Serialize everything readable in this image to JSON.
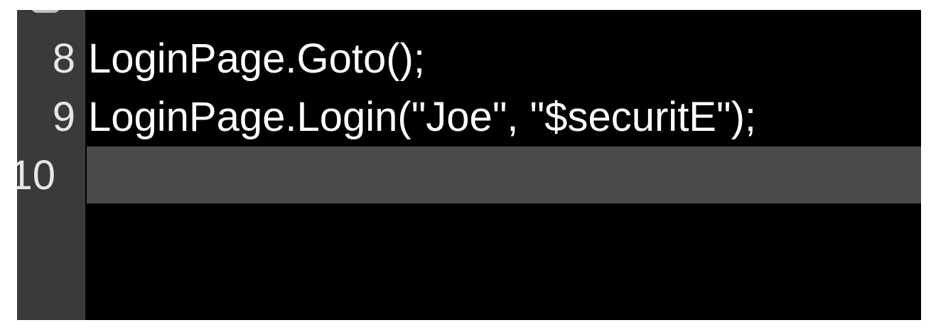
{
  "colors": {
    "editor_background": "#000000",
    "gutter_background": "#3a3a3a",
    "current_line_background": "#4a4a4a",
    "text": "#ffffff",
    "line_number_text": "#e6e6e6"
  },
  "lines": [
    {
      "number": "8",
      "code": "LoginPage.Goto();"
    },
    {
      "number": "9",
      "code": "LoginPage.Login(\"Joe\", \"$securitE\");"
    },
    {
      "number": "10",
      "code": ""
    }
  ]
}
